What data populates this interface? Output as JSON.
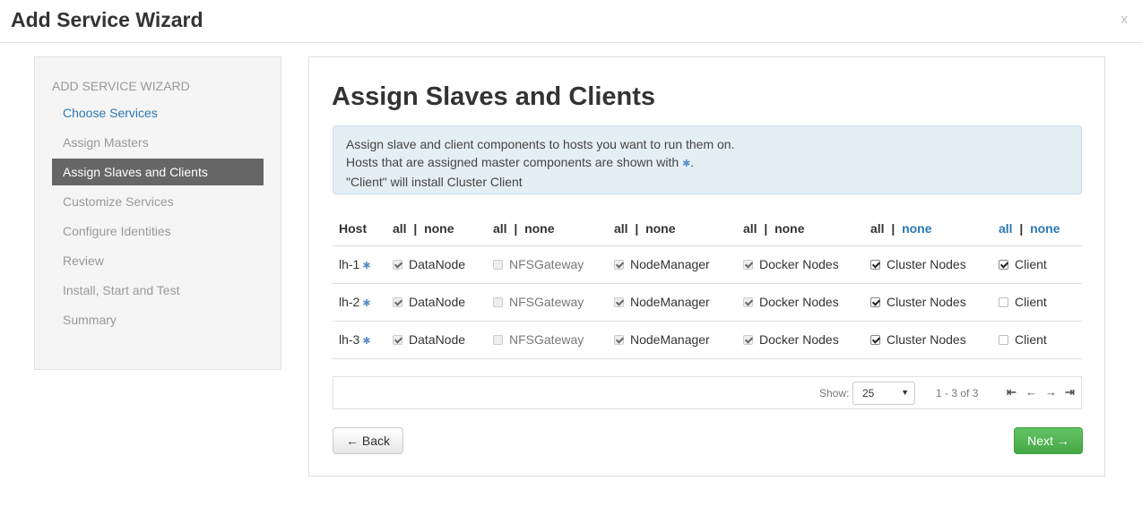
{
  "modal": {
    "title": "Add Service Wizard",
    "close": "x"
  },
  "sidebar": {
    "heading": "ADD SERVICE WIZARD",
    "items": [
      {
        "label": "Choose Services",
        "state": "link"
      },
      {
        "label": "Assign Masters",
        "state": "disabled"
      },
      {
        "label": "Assign Slaves and Clients",
        "state": "active"
      },
      {
        "label": "Customize Services",
        "state": "disabled"
      },
      {
        "label": "Configure Identities",
        "state": "disabled"
      },
      {
        "label": "Review",
        "state": "disabled"
      },
      {
        "label": "Install, Start and Test",
        "state": "disabled"
      },
      {
        "label": "Summary",
        "state": "disabled"
      }
    ]
  },
  "main": {
    "title": "Assign Slaves and Clients",
    "alert": {
      "line1": "Assign slave and client components to hosts you want to run them on.",
      "line2": "Hosts that are assigned master components are shown with",
      "line2_end": ".",
      "line3": "\"Client\" will install Cluster Client"
    },
    "table": {
      "host_header": "Host",
      "all_label": "all",
      "sep": "|",
      "none_label": "none",
      "rows": [
        {
          "host": "lh-1",
          "cells": [
            "DataNode",
            "NFSGateway",
            "NodeManager",
            "Docker Nodes",
            "Cluster Nodes",
            "Client"
          ],
          "checked": [
            true,
            false,
            true,
            true,
            true,
            true
          ]
        },
        {
          "host": "lh-2",
          "cells": [
            "DataNode",
            "NFSGateway",
            "NodeManager",
            "Docker Nodes",
            "Cluster Nodes",
            "Client"
          ],
          "checked": [
            true,
            false,
            true,
            true,
            true,
            false
          ]
        },
        {
          "host": "lh-3",
          "cells": [
            "DataNode",
            "NFSGateway",
            "NodeManager",
            "Docker Nodes",
            "Cluster Nodes",
            "Client"
          ],
          "checked": [
            true,
            false,
            true,
            true,
            true,
            false
          ]
        }
      ]
    },
    "pager": {
      "show_label": "Show:",
      "page_size": "25",
      "range": "1 - 3 of 3"
    },
    "buttons": {
      "back": "← Back",
      "next": "Next →"
    }
  },
  "colors": {
    "link": "#2a79b8",
    "active_bg": "#666666",
    "next_green": "#51b351",
    "alert_bg": "#e4eff5"
  }
}
